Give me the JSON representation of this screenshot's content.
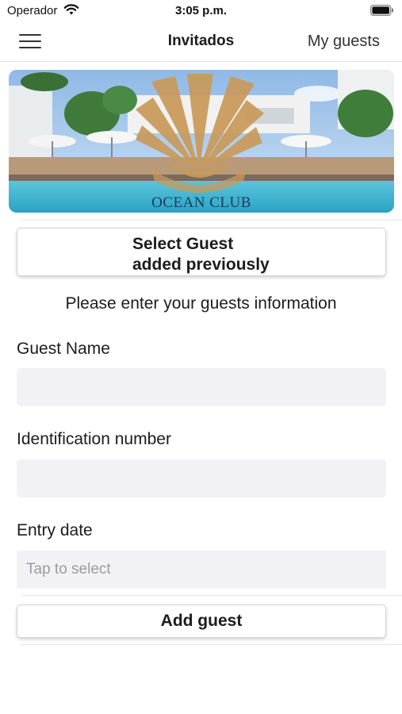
{
  "status_bar": {
    "carrier": "Operador",
    "time": "3:05 p.m.",
    "wifi_icon": "wifi-icon",
    "battery_icon": "battery-icon"
  },
  "nav": {
    "title": "Invitados",
    "right_label": "My guests",
    "menu_icon": "hamburger-menu-icon"
  },
  "banner": {
    "label": "OCEAN CLUB",
    "accent_color": "#c99a5a",
    "text_color": "#1f3a5a"
  },
  "select_guest_button": {
    "line1": "Select Guest",
    "line2": "added previously"
  },
  "instructions": "Please enter your guests information",
  "form": {
    "guest_name": {
      "label": "Guest Name",
      "value": "",
      "placeholder": ""
    },
    "identification": {
      "label": "Identification number",
      "value": "",
      "placeholder": ""
    },
    "entry_date": {
      "label": "Entry date",
      "value": "",
      "placeholder": "Tap to select"
    }
  },
  "add_button": {
    "label": "Add guest"
  }
}
